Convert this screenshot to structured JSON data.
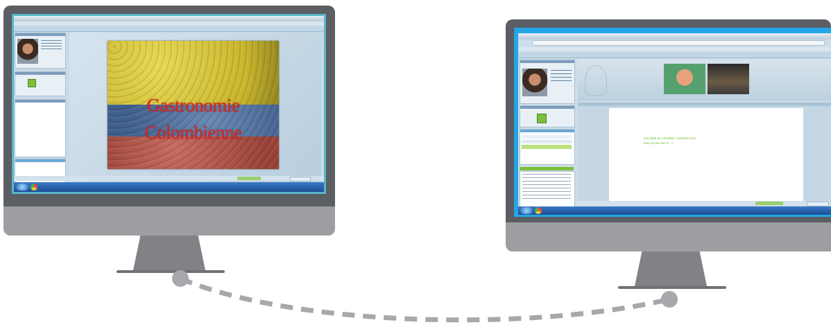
{
  "slide": {
    "line1": "Gastronomie",
    "line2": "Colombienne"
  },
  "whiteboard": {
    "line1": "Les plats de Colombie, voudriez-vous",
    "line2": "faire en par rien à ...?"
  },
  "colors": {
    "bezel": "#5b5e63",
    "chin": "#9c9ea1",
    "left_screen_frame": "#57b7c8",
    "right_screen_frame": "#22a6e6",
    "flag_yellow": "#d9c83a",
    "flag_blue": "#4f6f9c",
    "flag_red": "#b5574e",
    "slide_text": "#d8261f",
    "whiteboard_text": "#6cc12d",
    "connector": "#a6a8ab"
  }
}
